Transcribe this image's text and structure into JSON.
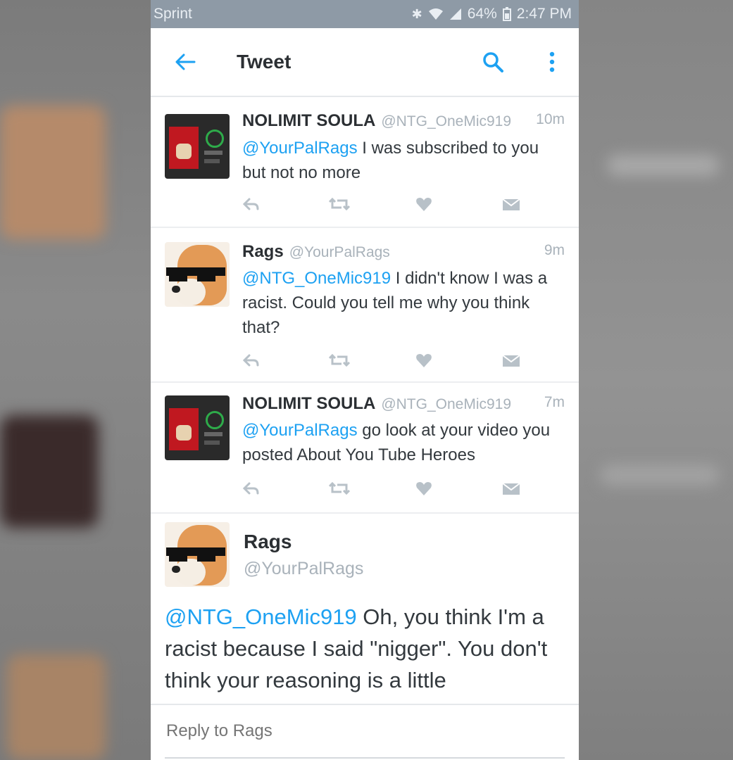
{
  "status_bar": {
    "carrier": "Sprint",
    "battery": "64%",
    "time": "2:47 PM"
  },
  "top_bar": {
    "title": "Tweet"
  },
  "tweets": [
    {
      "name": "NOLIMIT SOULA",
      "handle": "@NTG_OneMic919",
      "time": "10m",
      "mention": "@YourPalRags",
      "text": " I was subscribed to you but not no more",
      "avatar": "album-art-avatar"
    },
    {
      "name": "Rags",
      "handle": "@YourPalRags",
      "time": "9m",
      "mention": "@NTG_OneMic919",
      "text": " I didn't know I was a racist. Could you tell me why you think that?",
      "avatar": "dog-sunglasses-avatar"
    },
    {
      "name": "NOLIMIT SOULA",
      "handle": "@NTG_OneMic919",
      "time": "7m",
      "mention": "@YourPalRags",
      "text": " go look at your video you posted About You Tube Heroes",
      "avatar": "album-art-avatar"
    }
  ],
  "main_tweet": {
    "name": "Rags",
    "handle": "@YourPalRags",
    "mention": "@NTG_OneMic919",
    "text": " Oh, you think I'm a racist because I said \"nigger\". You don't think your reasoning is a little"
  },
  "reply": {
    "placeholder": "Reply to Rags"
  },
  "colors": {
    "accent": "#1da1f2",
    "status_bar": "#8e9aa6",
    "muted": "#a9b2ba"
  },
  "icons": [
    "back-arrow-icon",
    "search-icon",
    "more-vertical-icon",
    "reply-icon",
    "retweet-icon",
    "like-icon",
    "dm-icon"
  ]
}
